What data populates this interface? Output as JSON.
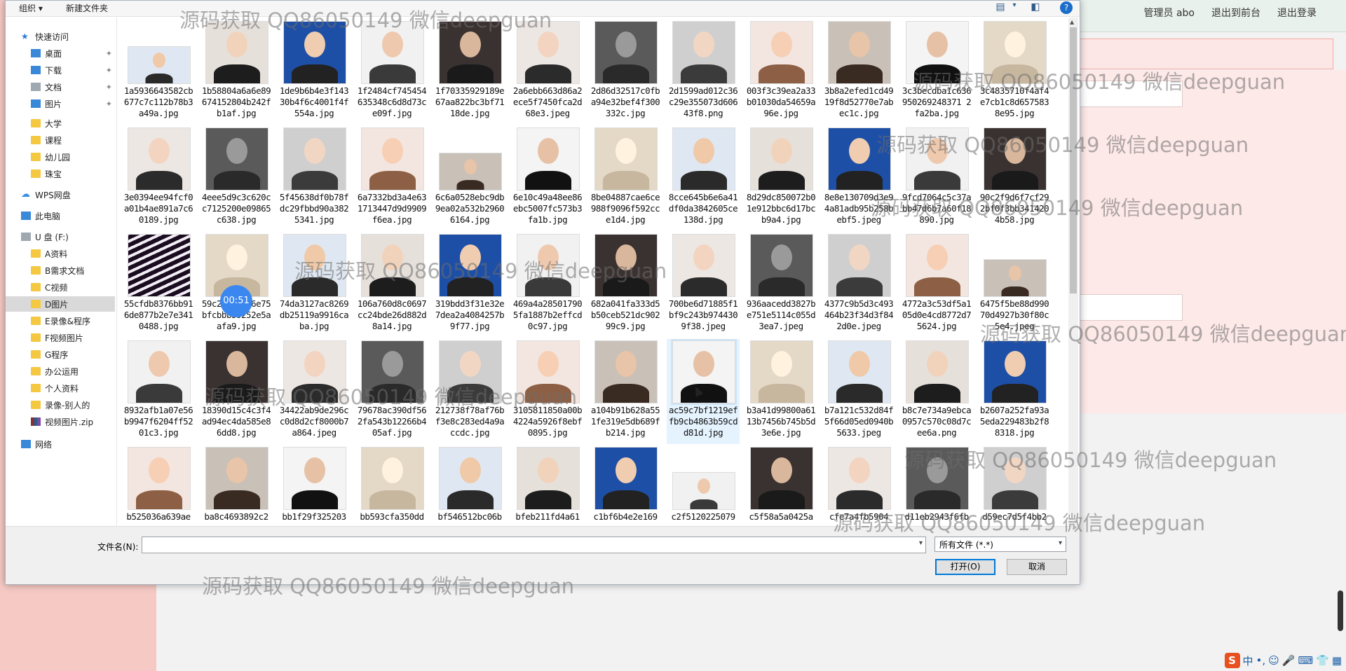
{
  "background_app": {
    "links": [
      "管理员 abo",
      "退出到前台",
      "退出登录"
    ]
  },
  "dialog": {
    "toolbar": {
      "organize": "组织 ▾",
      "new_folder": "新建文件夹",
      "view_icon": "view-icon",
      "help": "?"
    },
    "nav": [
      {
        "label": "快速访问",
        "icon": "star-icon",
        "kind": "star",
        "pinned": false
      },
      {
        "label": "桌面",
        "icon": "desktop-icon",
        "kind": "blue",
        "pinned": true
      },
      {
        "label": "下载",
        "icon": "download-icon",
        "kind": "blue",
        "pinned": true
      },
      {
        "label": "文档",
        "icon": "document-icon",
        "kind": "grey",
        "pinned": true
      },
      {
        "label": "图片",
        "icon": "picture-icon",
        "kind": "blue",
        "pinned": true
      },
      {
        "label": "大学",
        "icon": "folder-icon",
        "kind": "folder",
        "pinned": false
      },
      {
        "label": "课程",
        "icon": "folder-icon",
        "kind": "folder",
        "pinned": false
      },
      {
        "label": "幼儿园",
        "icon": "folder-icon",
        "kind": "folder",
        "pinned": false
      },
      {
        "label": "珠宝",
        "icon": "folder-icon",
        "kind": "folder",
        "pinned": false
      },
      {
        "label": "WPS网盘",
        "icon": "cloud-icon",
        "kind": "cloud",
        "pinned": false
      },
      {
        "label": "此电脑",
        "icon": "computer-icon",
        "kind": "blue",
        "pinned": false
      },
      {
        "label": "U 盘 (F:)",
        "icon": "usb-drive-icon",
        "kind": "grey",
        "pinned": false
      },
      {
        "label": "A资料",
        "icon": "folder-icon",
        "kind": "folder",
        "pinned": false
      },
      {
        "label": "B需求文档",
        "icon": "folder-icon",
        "kind": "folder",
        "pinned": false
      },
      {
        "label": "C视频",
        "icon": "folder-icon",
        "kind": "folder",
        "pinned": false
      },
      {
        "label": "D图片",
        "icon": "folder-icon",
        "kind": "folder",
        "pinned": false,
        "selected": true
      },
      {
        "label": "E录像&程序",
        "icon": "folder-icon",
        "kind": "folder",
        "pinned": false
      },
      {
        "label": "F视频图片",
        "icon": "folder-icon",
        "kind": "folder",
        "pinned": false
      },
      {
        "label": "G程序",
        "icon": "folder-icon",
        "kind": "folder",
        "pinned": false
      },
      {
        "label": "办公运用",
        "icon": "folder-icon",
        "kind": "folder",
        "pinned": false
      },
      {
        "label": "个人资料",
        "icon": "folder-icon",
        "kind": "folder",
        "pinned": false
      },
      {
        "label": "录像-别人的",
        "icon": "folder-icon",
        "kind": "folder",
        "pinned": false
      },
      {
        "label": "视频图片.zip",
        "icon": "zip-icon",
        "kind": "zip",
        "pinned": false
      },
      {
        "label": "网络",
        "icon": "network-icon",
        "kind": "blue",
        "pinned": false
      }
    ],
    "files": [
      [
        "1a5936643582cb677c7c112b78b3a49a.jpg",
        "1b58804a6a6e89674152804b242fb1af.jpg",
        "1de9b6b4e3f14330b4f6c4001f4f554a.jpg",
        "1f2484cf745454635348c6d8d73ce09f.jpg",
        "1f70335929189e67aa822bc3bf7118de.jpg",
        "2a6ebb663d86a2ece5f7450fca2d68e3.jpeg",
        "2d86d32517c0fba94e32bef4f300332c.jpg",
        "2d1599ad012c36c29e355073d60643f8.png",
        "003f3c39ea2a33b01030da54659a96e.jpg",
        "3b8a2efed1cd4919f8d52770e7abec1c.jpg",
        "3c3becdba1c636950269248371 2fa2ba.jpg",
        "3c4835710f4af4e7cb1c8d6575838e95.jpg"
      ],
      [
        "3e0394ee94fcf0a01b4ae891a7c60189.jpg",
        "4eee5d9c3c620cc7125200e09865c638.jpg",
        "5f45638df0b78fdc29fbbd90a3825341.jpg",
        "6a7332bd3a4e631713447d9d9909f6ea.jpg",
        "6c6a0528ebc9db9ea02a532b29606164.jpg",
        "6e10c49a48ee86ebc5007fc573b3fa1b.jpg",
        "8be04887cae6ce988f9096f592cce1d4.jpg",
        "8cce645b6e6a41df0da3842605ce138d.jpg",
        "8d29dc850072b01e912bbc6d17bcb9a4.jpg",
        "8e8e130709d3e94a81adb95b258bebf5.jpeg",
        "9fcd7064c5c37abb47d6b7a60f18890.jpg",
        "90c2f9d6f7cf292bf0f3bb3414204b58.jpg"
      ],
      [
        "55cfdb8376bb916de877b2e7e3410488.jpg",
        "59c2f344206e75bfcbbb39252e5aafa9.jpg",
        "74da3127ac8269db25119a9916caba.jpg",
        "106a760d8c0697cc24bde26d882d8a14.jpg",
        "319bdd3f31e32e7dea2a4084257b9f77.jpg",
        "469a4a285017905fa1887b2effcd0c97.jpg",
        "682a041fa333d5b50ceb521dc90299c9.jpg",
        "700be6d71885f1bf9c243b9744309f38.jpeg",
        "936aacedd3827be751e5114c055d3ea7.jpeg",
        "4377c9b5d3c493464b23f34d3f842d0e.jpeg",
        "4772a3c53df5a105d0e4cd8772d75624.jpg",
        "6475f5be88d99070d4927b30f80c5e4.jpeg"
      ],
      [
        "8932afb1a07e56b9947f6204ff5201c3.jpg",
        "18390d15c4c3f4ad94ec4da585e86dd8.jpg",
        "34422ab9de296cc0d8d2cf8000b7a864.jpeg",
        "79678ac390df562fa543b12266b405af.jpg",
        "212738f78af76bf3e8c283ed4a9accdc.jpg",
        "3105811850a00b4224a5926f8ebf0895.jpg",
        "a104b91b628a551fe319e5db689fb214.jpg",
        "ac59c7bf1219effb9cb4863b59cdd81d.jpg",
        "b3a41d99800a6113b7456b745b5d3e6e.jpg",
        "b7a121c532d84f5f66d05ed0940b5633.jpeg",
        "b8c7e734a9ebca0957c570c08d7cee6a.png",
        "b2607a252fa93a5eda229483b2f88318.jpg"
      ],
      [
        "b525036a639ae",
        "ba8c4693892c2",
        "bb1f29f325203",
        "bb593cfa350dd",
        "bf546512bc06b",
        "bfeb211fd4a61",
        "c1bf6b4e2e169",
        "c2f5120225079",
        "c5f58a5a0425a",
        "cfe7a4fb5904",
        "d11eb2943f6fb",
        "d59ec7d5f4bb2"
      ]
    ],
    "timer": "00:51",
    "filename_label": "文件名(N):",
    "filename_value": "",
    "filter": "所有文件 (*.*)",
    "open_button": "打开(O)",
    "cancel_button": "取消"
  },
  "watermark": "源码获取 QQ86050149 微信deepguan",
  "tray": [
    "S",
    "中",
    "•,",
    "☺",
    "🎤",
    "⌨",
    "👕",
    "▦"
  ]
}
